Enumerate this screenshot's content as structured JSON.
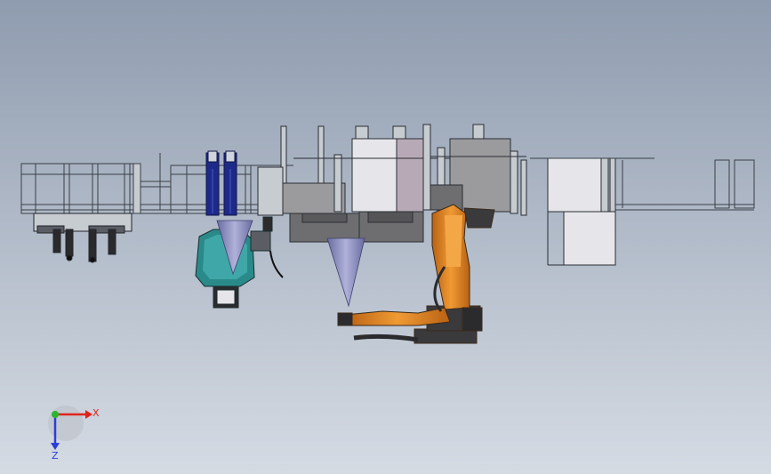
{
  "scene": {
    "background_top": "#8f9caf",
    "background_bottom": "#d5dbe3"
  },
  "colors": {
    "frame_stroke": "#3a3f46",
    "frame_fill": "#c7ccd1",
    "panel_light": "#e6e6ea",
    "panel_mauve": "#b8a9b6",
    "panel_gray": "#9b9b9e",
    "panel_dark": "#6e6e70",
    "robot_orange": "#e0841f",
    "robot_dark": "#3a2a1a",
    "blue_cylinder": "#1e2a8a",
    "teal_robot": "#2a8a8a",
    "spray_cone": "#8d8fc0",
    "axis_x": "#e0231a",
    "axis_y": "#2bb62b",
    "axis_z": "#2a3fd6"
  },
  "triad": {
    "x_label": "X",
    "z_label": "Z"
  },
  "components": [
    {
      "name": "left-railing-frame"
    },
    {
      "name": "left-cart"
    },
    {
      "name": "blue-gas-cylinders"
    },
    {
      "name": "teal-spray-robot"
    },
    {
      "name": "spray-cone-left"
    },
    {
      "name": "spray-cone-center"
    },
    {
      "name": "spray-booth-left"
    },
    {
      "name": "spray-booth-right"
    },
    {
      "name": "orange-industrial-robot"
    },
    {
      "name": "right-enclosure"
    },
    {
      "name": "right-railing-frame"
    }
  ]
}
